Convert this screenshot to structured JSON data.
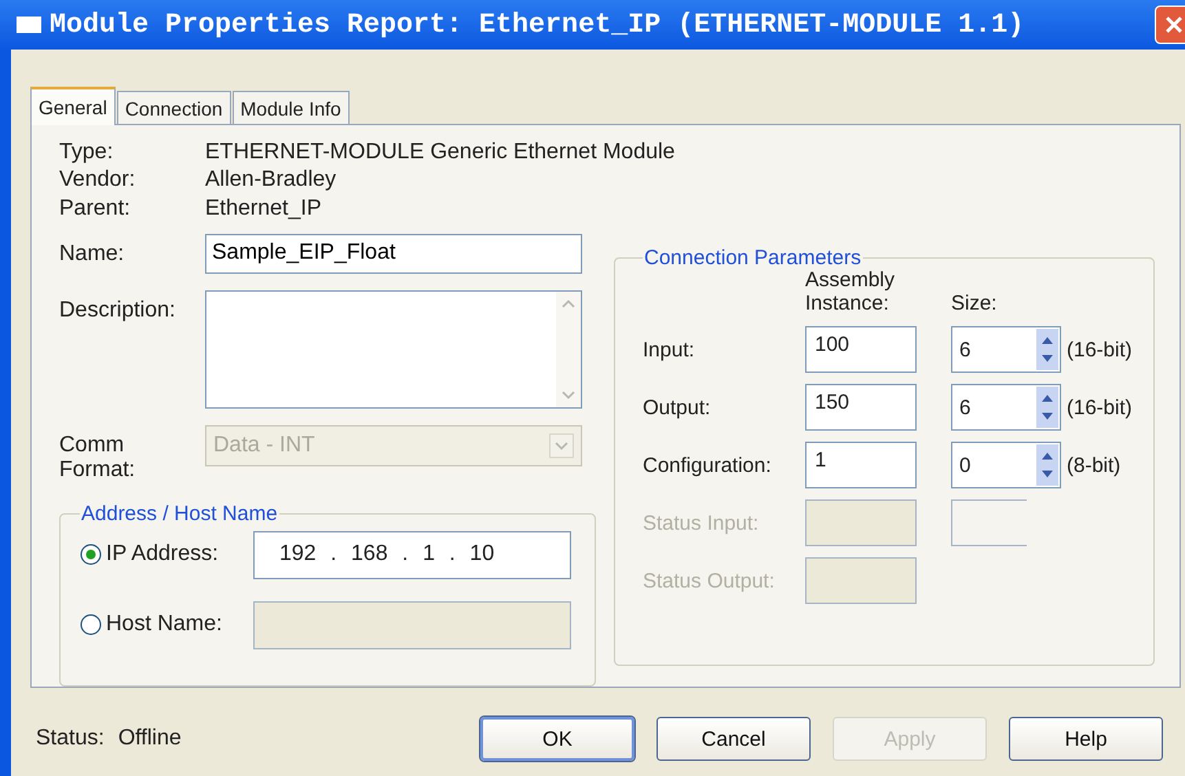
{
  "window": {
    "title": "Module Properties Report: Ethernet_IP (ETHERNET-MODULE 1.1)"
  },
  "tabs": [
    {
      "label": "General",
      "selected": true
    },
    {
      "label": "Connection",
      "selected": false
    },
    {
      "label": "Module Info",
      "selected": false
    }
  ],
  "info": [
    {
      "label": "Type:",
      "value": "ETHERNET-MODULE Generic Ethernet Module"
    },
    {
      "label": "Vendor:",
      "value": "Allen-Bradley"
    },
    {
      "label": "Parent:",
      "value": "Ethernet_IP"
    }
  ],
  "name": {
    "label": "Name:",
    "value": "Sample_EIP_Float"
  },
  "description": {
    "label": "Description:"
  },
  "comm_format": {
    "label": "Comm Format:",
    "value": "Data - INT",
    "disabled": true
  },
  "address": {
    "title": "Address / Host Name",
    "options": [
      {
        "label": "IP Address:",
        "selected": true,
        "value": "192 . 168 . 1 . 10"
      },
      {
        "label": "Host Name:",
        "selected": false
      }
    ]
  },
  "connection": {
    "title": "Connection Parameters",
    "headers": [
      "Assembly Instance:",
      "Size:"
    ],
    "rows": [
      {
        "label": "Input:",
        "disabled": false,
        "instance": "100",
        "size": "6",
        "unit": "(16-bit)",
        "has_size": true
      },
      {
        "label": "Output:",
        "disabled": false,
        "instance": "150",
        "size": "6",
        "unit": "(16-bit)",
        "has_size": true
      },
      {
        "label": "Configuration:",
        "disabled": false,
        "instance": "1",
        "size": "0",
        "unit": "(8-bit)",
        "has_size": true
      },
      {
        "label": "Status Input:",
        "disabled": true,
        "has_size": true
      },
      {
        "label": "Status Output:",
        "disabled": true,
        "has_size": false
      }
    ]
  },
  "status": {
    "label": "Status:",
    "value": "Offline"
  },
  "buttons": [
    {
      "label": "OK",
      "default": true,
      "disabled": false
    },
    {
      "label": "Cancel",
      "default": false,
      "disabled": false
    },
    {
      "label": "Apply",
      "default": false,
      "disabled": true
    },
    {
      "label": "Help",
      "default": false,
      "disabled": false
    }
  ]
}
